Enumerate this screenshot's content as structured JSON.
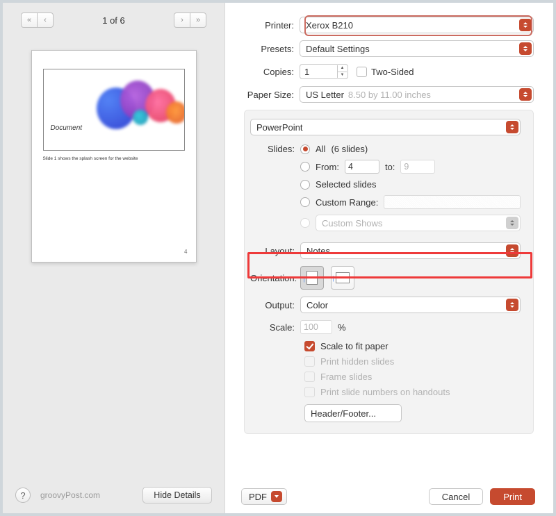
{
  "nav": {
    "page_counter": "1 of 6",
    "prev_first_glyph": "«",
    "prev_glyph": "‹",
    "next_glyph": "›",
    "next_last_glyph": "»"
  },
  "preview": {
    "slide_text": "Document",
    "caption": "Slide 1 shows the splash screen for the website",
    "page_number": "4"
  },
  "left_footer": {
    "help_glyph": "?",
    "watermark": "groovyPost.com",
    "hide_details": "Hide Details"
  },
  "labels": {
    "printer": "Printer:",
    "presets": "Presets:",
    "copies": "Copies:",
    "two_sided": "Two-Sided",
    "paper_size": "Paper Size:",
    "slides": "Slides:",
    "layout": "Layout:",
    "orientation": "Orientation:",
    "output": "Output:",
    "scale": "Scale:",
    "percent": "%",
    "from": "From:",
    "to": "to:"
  },
  "values": {
    "printer": "Xerox B210",
    "presets": "Default Settings",
    "copies": "1",
    "paper_size": "US Letter",
    "paper_size_detail": "8.50 by 11.00 inches",
    "app_dropdown": "PowerPoint",
    "layout": "Notes",
    "output": "Color",
    "scale": "100",
    "from_value": "4",
    "to_value": "9"
  },
  "slides_options": {
    "all": "All",
    "all_count": "(6 slides)",
    "from": "From:",
    "selected": "Selected slides",
    "custom_range": "Custom Range:",
    "custom_shows": "Custom Shows"
  },
  "checks": {
    "scale_fit": "Scale to fit paper",
    "hidden": "Print hidden slides",
    "frame": "Frame slides",
    "slide_numbers": "Print slide numbers on handouts"
  },
  "buttons": {
    "header_footer": "Header/Footer...",
    "pdf": "PDF",
    "cancel": "Cancel",
    "print": "Print"
  }
}
